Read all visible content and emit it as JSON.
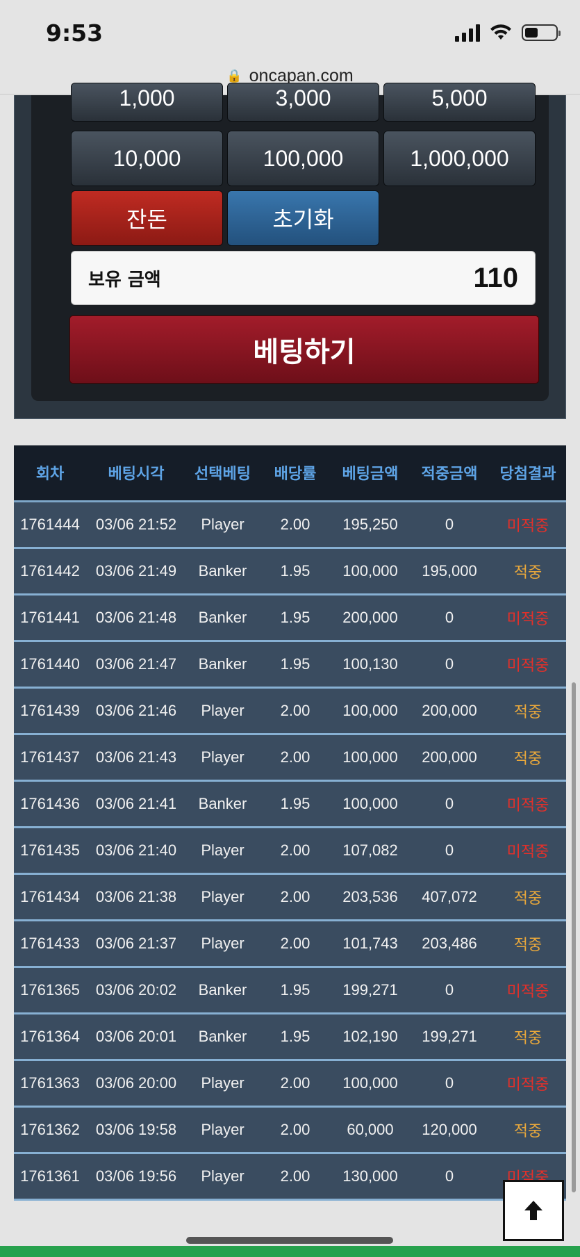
{
  "status_bar": {
    "time": "9:53"
  },
  "browser": {
    "url": "oncapan.com",
    "lock_icon": "lock-icon"
  },
  "chips": {
    "row1": [
      "1,000",
      "3,000",
      "5,000"
    ],
    "row2": [
      "10,000",
      "100,000",
      "1,000,000"
    ]
  },
  "actions": {
    "change_label": "잔돈",
    "reset_label": "초기화"
  },
  "balance": {
    "label": "보유 금액",
    "value": "110"
  },
  "bet_button": {
    "label": "베팅하기"
  },
  "table": {
    "headers": [
      "회차",
      "베팅시각",
      "선택베팅",
      "배당률",
      "베팅금액",
      "적중금액",
      "당첨결과"
    ],
    "rows": [
      [
        "1761444",
        "03/06 21:52",
        "Player",
        "2.00",
        "195,250",
        "0",
        "미적중"
      ],
      [
        "1761442",
        "03/06 21:49",
        "Banker",
        "1.95",
        "100,000",
        "195,000",
        "적중"
      ],
      [
        "1761441",
        "03/06 21:48",
        "Banker",
        "1.95",
        "200,000",
        "0",
        "미적중"
      ],
      [
        "1761440",
        "03/06 21:47",
        "Banker",
        "1.95",
        "100,130",
        "0",
        "미적중"
      ],
      [
        "1761439",
        "03/06 21:46",
        "Player",
        "2.00",
        "100,000",
        "200,000",
        "적중"
      ],
      [
        "1761437",
        "03/06 21:43",
        "Player",
        "2.00",
        "100,000",
        "200,000",
        "적중"
      ],
      [
        "1761436",
        "03/06 21:41",
        "Banker",
        "1.95",
        "100,000",
        "0",
        "미적중"
      ],
      [
        "1761435",
        "03/06 21:40",
        "Player",
        "2.00",
        "107,082",
        "0",
        "미적중"
      ],
      [
        "1761434",
        "03/06 21:38",
        "Player",
        "2.00",
        "203,536",
        "407,072",
        "적중"
      ],
      [
        "1761433",
        "03/06 21:37",
        "Player",
        "2.00",
        "101,743",
        "203,486",
        "적중"
      ],
      [
        "1761365",
        "03/06 20:02",
        "Banker",
        "1.95",
        "199,271",
        "0",
        "미적중"
      ],
      [
        "1761364",
        "03/06 20:01",
        "Banker",
        "1.95",
        "102,190",
        "199,271",
        "적중"
      ],
      [
        "1761363",
        "03/06 20:00",
        "Player",
        "2.00",
        "100,000",
        "0",
        "미적중"
      ],
      [
        "1761362",
        "03/06 19:58",
        "Player",
        "2.00",
        "60,000",
        "120,000",
        "적중"
      ],
      [
        "1761361",
        "03/06 19:56",
        "Player",
        "2.00",
        "130,000",
        "0",
        "미적중"
      ]
    ],
    "hit_text": "적중",
    "colors": {
      "hit": "#e9a83b",
      "miss": "#e3302a",
      "header_text": "#5ea4e6"
    }
  },
  "scroll_top_button": {
    "icon": "arrow-up-icon"
  }
}
